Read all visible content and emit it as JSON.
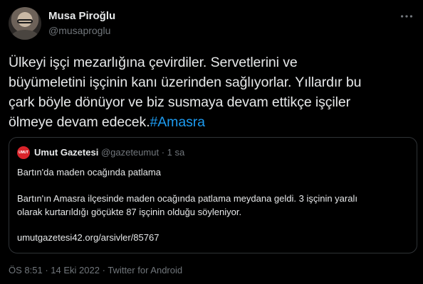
{
  "author": {
    "display_name": "Musa Piroğlu",
    "handle": "@musaproglu"
  },
  "more_icon": "more-horizontal-icon",
  "tweet": {
    "lines": [
      "Ülkeyi işçi mezarlığına çevirdiler. Servetlerini ve",
      "büyümeletini işçinin kanı üzerinden sağlıyorlar. Yıllardır bu",
      "çark böyle dönüyor ve biz susmaya devam ettikçe işçiler",
      "ölmeye devam edecek."
    ],
    "hashtag": "#Amasra"
  },
  "quote": {
    "avatar_text": "UMUT",
    "avatar_color": "#d8232a",
    "name": "Umut Gazetesi",
    "handle": "@gazeteumut",
    "separator": "·",
    "time": "1 sa",
    "title": "Bartın'da maden ocağında patlama",
    "body_lines": [
      "Bartın'ın Amasra ilçesinde maden ocağında patlama meydana geldi. 3 işçinin yaralı",
      "olarak kurtarıldığı göçükte 87 işçinin olduğu söyleniyor."
    ],
    "link": "umutgazetesi42.org/arsivler/85767"
  },
  "footer": {
    "time": "ÖS 8:51",
    "date": "14 Eki 2022",
    "source": "Twitter for Android",
    "separator": "·"
  },
  "colors": {
    "background": "#000000",
    "text": "#e7e9ea",
    "muted": "#71767b",
    "accent": "#1d9bf0",
    "border": "#2f3336"
  }
}
